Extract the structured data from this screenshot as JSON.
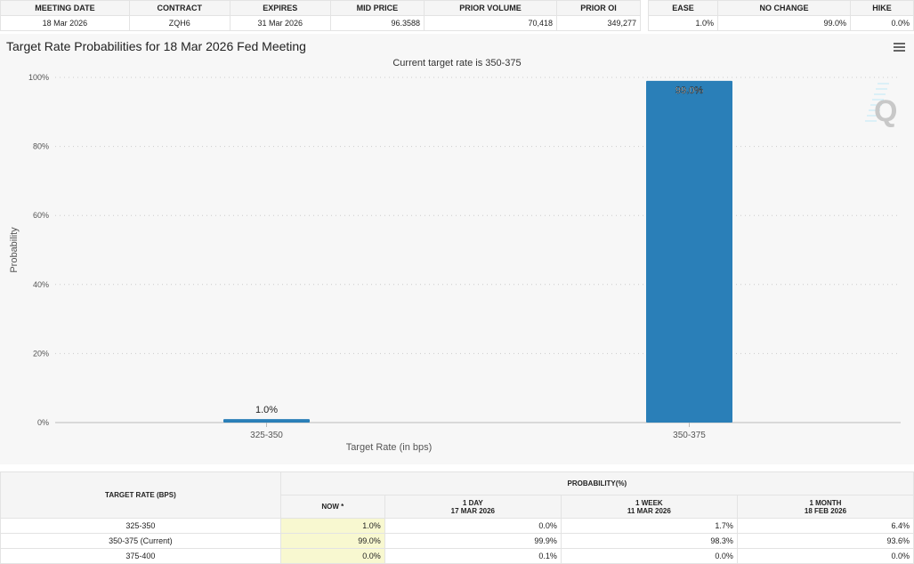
{
  "top_table": {
    "headers": [
      "MEETING DATE",
      "CONTRACT",
      "EXPIRES",
      "MID PRICE",
      "PRIOR VOLUME",
      "PRIOR OI"
    ],
    "row": [
      "18 Mar 2026",
      "ZQH6",
      "31 Mar 2026",
      "96.3588",
      "70,418",
      "349,277"
    ]
  },
  "outcome_table": {
    "headers": [
      "EASE",
      "NO CHANGE",
      "HIKE"
    ],
    "row": [
      "1.0%",
      "99.0%",
      "0.0%"
    ]
  },
  "chart_data": {
    "type": "bar",
    "title": "Target Rate Probabilities for 18 Mar 2026 Fed Meeting",
    "subtitle": "Current target rate is 350-375",
    "xlabel": "Target Rate (in bps)",
    "ylabel": "Probability",
    "categories": [
      "325-350",
      "350-375"
    ],
    "values": [
      1.0,
      99.0
    ],
    "data_labels": [
      "1.0%",
      "99.0%"
    ],
    "ylim": [
      0,
      100
    ],
    "yticks": [
      "0%",
      "20%",
      "40%",
      "60%",
      "80%",
      "100%"
    ],
    "grid": true,
    "bar_color": "#2a7fb8"
  },
  "prob_table": {
    "rate_header": "TARGET RATE (BPS)",
    "prob_header": "PROBABILITY(%)",
    "columns": [
      {
        "l1": "NOW *",
        "l2": ""
      },
      {
        "l1": "1 DAY",
        "l2": "17 MAR 2026"
      },
      {
        "l1": "1 WEEK",
        "l2": "11 MAR 2026"
      },
      {
        "l1": "1 MONTH",
        "l2": "18 FEB 2026"
      }
    ],
    "rows": [
      {
        "rate": "325-350",
        "vals": [
          "1.0%",
          "0.0%",
          "1.7%",
          "6.4%"
        ]
      },
      {
        "rate": "350-375 (Current)",
        "vals": [
          "99.0%",
          "99.9%",
          "98.3%",
          "93.6%"
        ]
      },
      {
        "rate": "375-400",
        "vals": [
          "0.0%",
          "0.1%",
          "0.0%",
          "0.0%"
        ]
      }
    ]
  }
}
